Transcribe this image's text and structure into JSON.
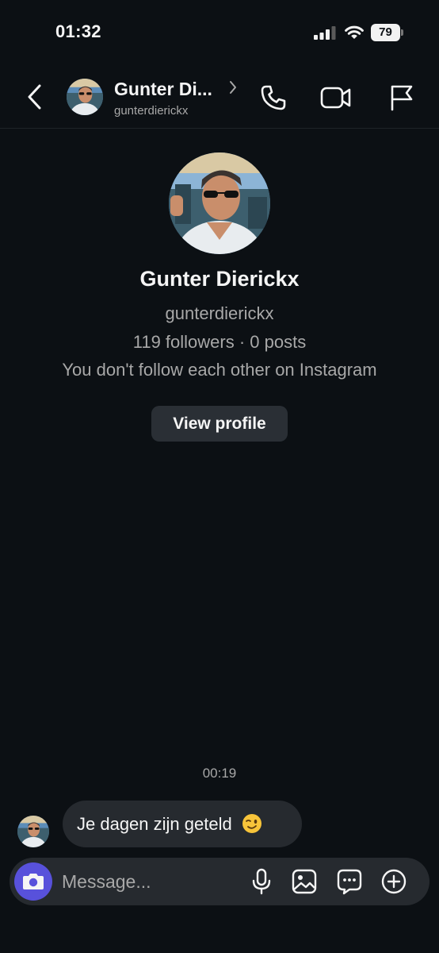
{
  "status_bar": {
    "time": "01:32",
    "battery": "79"
  },
  "header": {
    "name": "Gunter Di...",
    "username": "gunterdierickx"
  },
  "profile": {
    "name": "Gunter Dierickx",
    "username": "gunterdierickx",
    "stats": "119 followers · 0 posts",
    "relationship": "You don't follow each other on Instagram",
    "view_profile_label": "View profile"
  },
  "thread": {
    "timestamp": "00:19",
    "messages": [
      {
        "text": "Je dagen zijn geteld",
        "emoji": "winking-face"
      }
    ]
  },
  "composer": {
    "placeholder": "Message..."
  },
  "colors": {
    "background": "#0c1014",
    "bubble": "#262a2f",
    "accent": "#5851db",
    "muted_text": "#a8a8a8"
  },
  "icons": [
    "back-icon",
    "chevron-right-icon",
    "phone-icon",
    "video-camera-icon",
    "flag-icon",
    "camera-icon",
    "microphone-icon",
    "gallery-icon",
    "sticker-icon",
    "plus-icon"
  ]
}
